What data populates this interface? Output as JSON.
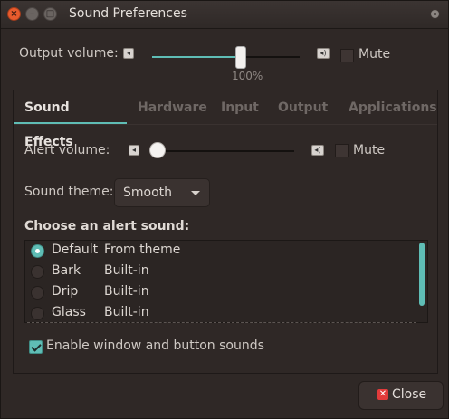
{
  "window": {
    "title": "Sound Preferences"
  },
  "output": {
    "label": "Output volume:",
    "value_label": "100%",
    "mute_label": "Mute",
    "level": 0.6
  },
  "tabs": [
    {
      "label": "Sound Effects"
    },
    {
      "label": "Hardware"
    },
    {
      "label": "Input"
    },
    {
      "label": "Output"
    },
    {
      "label": "Applications"
    }
  ],
  "effects": {
    "alert_label": "Alert volume:",
    "alert_mute_label": "Mute",
    "alert_level": 0.0,
    "theme_label": "Sound theme:",
    "theme_value": "Smooth",
    "choose_label": "Choose an alert sound:",
    "sounds": [
      {
        "name": "Default",
        "type": "From theme"
      },
      {
        "name": "Bark",
        "type": "Built-in"
      },
      {
        "name": "Drip",
        "type": "Built-in"
      },
      {
        "name": "Glass",
        "type": "Built-in"
      }
    ],
    "enable_label": "Enable window and button sounds"
  },
  "footer": {
    "close_label": "Close"
  },
  "colors": {
    "accent": "#5fbdb5",
    "background": "#2f2826",
    "close_red": "#e23b3b"
  },
  "icons": [
    "speaker-low-icon",
    "speaker-high-icon",
    "close-icon",
    "check-icon",
    "dropdown-arrow-icon"
  ]
}
